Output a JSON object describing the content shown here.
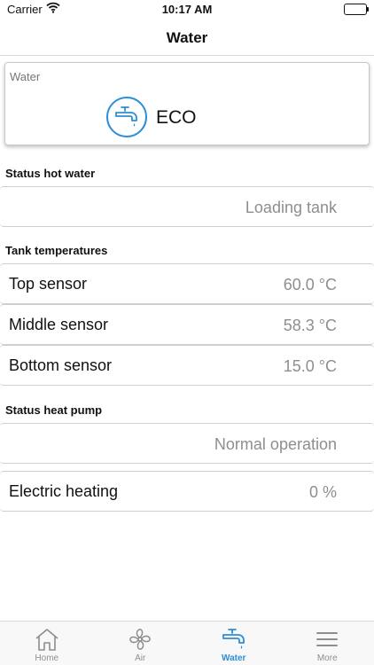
{
  "status_bar": {
    "carrier": "Carrier",
    "time": "10:17 AM"
  },
  "nav": {
    "title": "Water"
  },
  "mode_card": {
    "title": "Water",
    "mode": "ECO",
    "icon": "faucet-icon",
    "accent": "#2b8fd6"
  },
  "sections": {
    "hot_water": "Status hot water",
    "tank": "Tank temperatures",
    "heat_pump": "Status heat pump"
  },
  "rows": {
    "hot_water_status": {
      "label": "",
      "value": "Loading tank"
    },
    "top_sensor": {
      "label": "Top sensor",
      "value": "60.0 °C"
    },
    "middle_sensor": {
      "label": "Middle sensor",
      "value": "58.3 °C"
    },
    "bottom_sensor": {
      "label": "Bottom sensor",
      "value": "15.0 °C"
    },
    "heat_pump_status": {
      "label": "",
      "value": "Normal operation"
    },
    "electric_heating": {
      "label": "Electric heating",
      "value": "0 %"
    }
  },
  "tabs": [
    {
      "label": "Home",
      "icon": "home-icon"
    },
    {
      "label": "Air",
      "icon": "fan-icon"
    },
    {
      "label": "Water",
      "icon": "faucet-icon",
      "active": true
    },
    {
      "label": "More",
      "icon": "menu-icon"
    }
  ]
}
